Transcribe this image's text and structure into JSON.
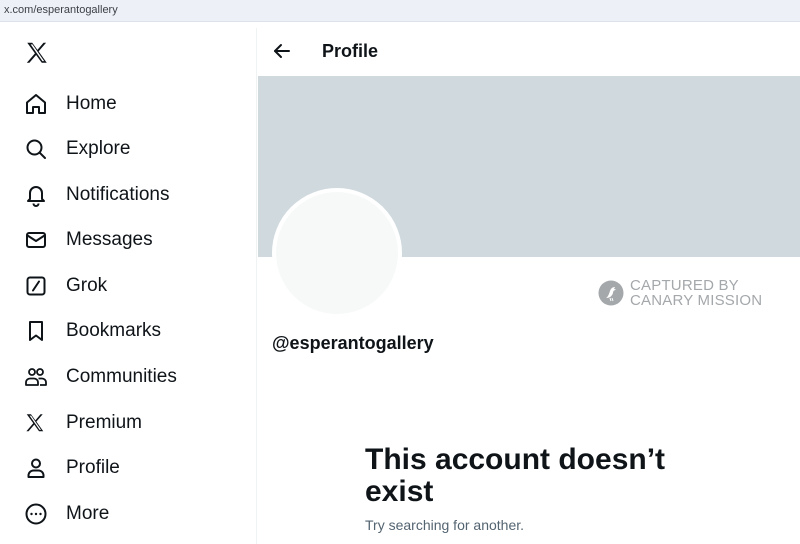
{
  "browser": {
    "url": "x.com/esperantogallery"
  },
  "sidebar": {
    "logo_icon": "x-logo-icon",
    "items": [
      {
        "label": "Home",
        "icon": "home-icon"
      },
      {
        "label": "Explore",
        "icon": "search-icon"
      },
      {
        "label": "Notifications",
        "icon": "bell-icon"
      },
      {
        "label": "Messages",
        "icon": "envelope-icon"
      },
      {
        "label": "Grok",
        "icon": "grok-icon"
      },
      {
        "label": "Bookmarks",
        "icon": "bookmark-icon"
      },
      {
        "label": "Communities",
        "icon": "communities-icon"
      },
      {
        "label": "Premium",
        "icon": "x-logo-icon"
      },
      {
        "label": "Profile",
        "icon": "person-icon"
      },
      {
        "label": "More",
        "icon": "more-circle-icon"
      }
    ]
  },
  "header": {
    "title": "Profile",
    "back_icon": "arrow-left-icon"
  },
  "profile": {
    "handle": "@esperantogallery",
    "banner_color": "#cfd9de",
    "avatar_color": "#f7f9f9"
  },
  "watermark": {
    "line1": "CAPTURED BY",
    "line2": "CANARY MISSION"
  },
  "empty_state": {
    "title": "This account doesn’t exist",
    "subtitle": "Try searching for another."
  }
}
